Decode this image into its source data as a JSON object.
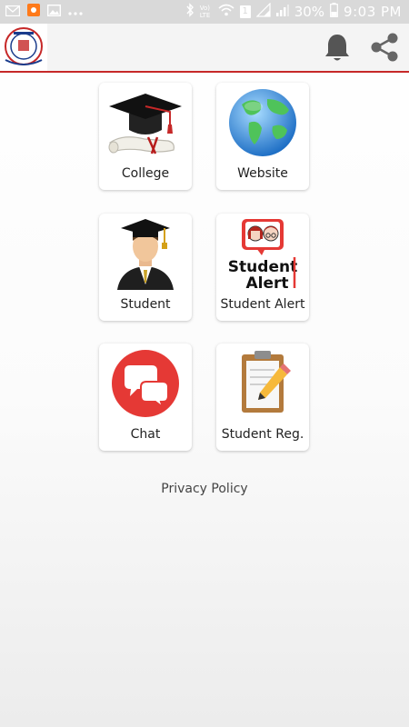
{
  "status_bar": {
    "left_icons": [
      "email-icon",
      "app-notification-icon",
      "gallery-icon",
      "more-dots-icon"
    ],
    "right_icons": [
      "bluetooth-icon",
      "volte-icon",
      "wifi-icon",
      "sim-1-icon",
      "signal-icon",
      "signal-icon",
      "battery-icon"
    ],
    "volte_text": "Vo)\nLTE",
    "sim_label": "1",
    "battery_percent": "30%",
    "time": "9:03 PM"
  },
  "app_bar": {
    "logo": "college-logo",
    "actions": [
      {
        "icon": "bell-icon"
      },
      {
        "icon": "share-icon"
      }
    ],
    "accent_color": "#c62828"
  },
  "tiles": [
    {
      "label": "College",
      "icon": "graduation-cap-icon"
    },
    {
      "label": "Website",
      "icon": "globe-icon"
    },
    {
      "label": "Student",
      "icon": "graduate-student-icon"
    },
    {
      "label": "Student Alert",
      "icon": "student-alert-icon",
      "icon_text": "Student Alert"
    },
    {
      "label": "Chat",
      "icon": "chat-bubbles-icon"
    },
    {
      "label": "Student Reg.",
      "icon": "clipboard-pencil-icon"
    }
  ],
  "footer": {
    "privacy_label": "Privacy Policy"
  }
}
